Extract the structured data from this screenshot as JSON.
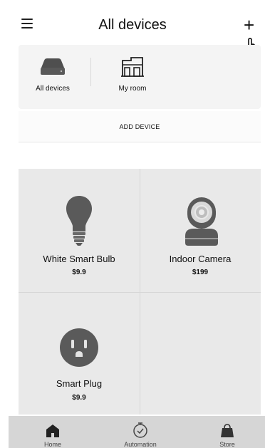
{
  "header": {
    "title": "All devices",
    "add_icon": "plus-icon",
    "menu_icon": "hamburger-menu-icon"
  },
  "tabs": [
    {
      "label": "All devices",
      "icon": "hub-device-icon"
    },
    {
      "label": "My room",
      "icon": "house-icon"
    }
  ],
  "add_device": {
    "label": "ADD DEVICE"
  },
  "products": [
    {
      "name": "White Smart Bulb",
      "price": "$9.9",
      "icon": "light-bulb-icon"
    },
    {
      "name": "Indoor Camera",
      "price": "$199",
      "icon": "camera-icon"
    },
    {
      "name": "Smart Plug",
      "price": "$9.9",
      "icon": "smart-plug-icon"
    }
  ],
  "bottom_nav": [
    {
      "label": "Home",
      "icon": "home-icon"
    },
    {
      "label": "Automation",
      "icon": "timer-icon"
    },
    {
      "label": "Store",
      "icon": "store-bag-icon"
    }
  ],
  "colors": {
    "icon_gray": "#5a5a5a",
    "card_bg": "#f4f4f4",
    "grid_bg": "#e9e9e9",
    "nav_bg": "#d6d6d6"
  }
}
